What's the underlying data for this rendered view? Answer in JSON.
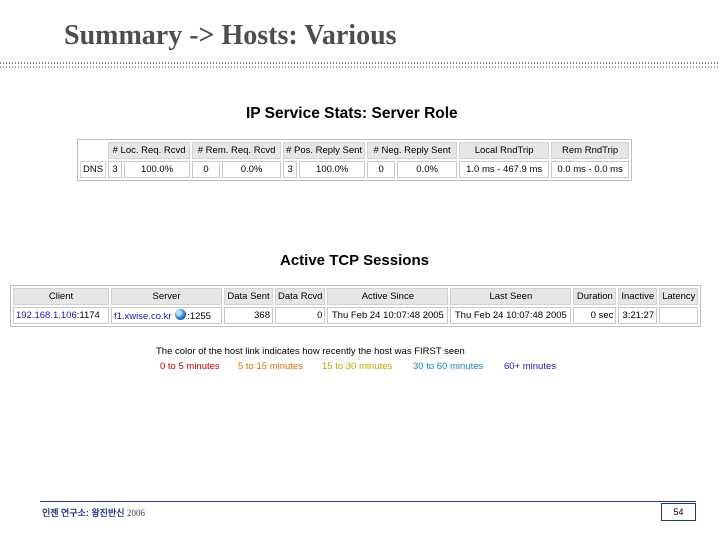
{
  "slide": {
    "title": "Summary -> Hosts: Various",
    "footer_text": "인젠 연구소: 왕진반신",
    "footer_year": "2006",
    "page_number": "54"
  },
  "ip_stats": {
    "heading": "IP Service Stats: Server Role",
    "columns": [
      "",
      "# Loc. Req. Rcvd",
      "# Rem. Req. Rcvd",
      "# Pos. Reply Sent",
      "# Neg. Reply Sent",
      "Local RndTrip",
      "Rem RndTrip"
    ],
    "rows": [
      {
        "service": "DNS",
        "loc_req_count": "3",
        "loc_req_pct": "100.0%",
        "rem_req_count": "0",
        "rem_req_pct": "0.0%",
        "pos_reply_count": "3",
        "pos_reply_pct": "100.0%",
        "neg_reply_count": "0",
        "neg_reply_pct": "0.0%",
        "local_rndtrip": "1.0 ms - 467.9 ms",
        "rem_rndtrip": "0.0 ms - 0.0 ms"
      }
    ]
  },
  "tcp_sessions": {
    "heading": "Active TCP Sessions",
    "columns": [
      "Client",
      "Server",
      "Data Sent",
      "Data Rcvd",
      "Active Since",
      "Last Seen",
      "Duration",
      "Inactive",
      "Latency"
    ],
    "rows": [
      {
        "client": "192.168.1.106",
        "client_port": ":1174",
        "server": "f1.xwise.co.kr",
        "server_port": ":1255",
        "data_sent": "368",
        "data_rcvd": "0",
        "active_since": "Thu Feb 24 10:07:48 2005",
        "last_seen": "Thu Feb 24 10:07:48 2005",
        "duration": "0 sec",
        "inactive": "3:21:27",
        "latency": ""
      }
    ]
  },
  "legend": {
    "caption": "The color of the host link indicates how recently the host was FIRST seen",
    "items": [
      {
        "label": "0 to 5 minutes",
        "color": "#c00000"
      },
      {
        "label": "5 to 15 minutes",
        "color": "#e07000"
      },
      {
        "label": "15 to 30 minutes",
        "color": "#c0a000"
      },
      {
        "label": "30 to 60 minutes",
        "color": "#1a7fc0"
      },
      {
        "label": "60+ minutes",
        "color": "#1a1aa6"
      }
    ]
  }
}
